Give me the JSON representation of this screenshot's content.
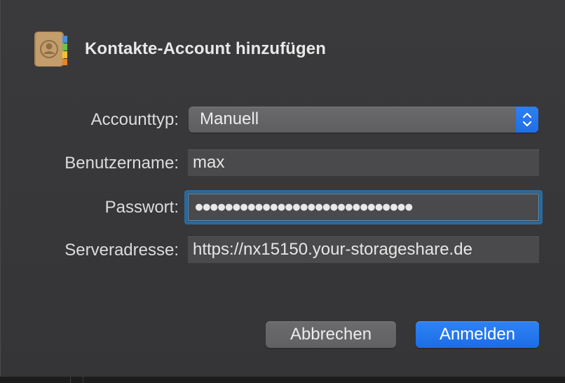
{
  "dialog": {
    "title": "Kontakte-Account hinzufügen",
    "app_icon": "contacts-app-icon"
  },
  "form": {
    "account_type": {
      "label": "Accounttyp:",
      "value": "Manuell",
      "icon": "chevron-up-down-icon"
    },
    "username": {
      "label": "Benutzername:",
      "value": "max"
    },
    "password": {
      "label": "Passwort:",
      "masked_value": "●●●●●●●●●●●●●●●●●●●●●●●●●●●●●"
    },
    "server": {
      "label": "Serveradresse:",
      "value": "https://nx15150.your-storageshare.de"
    }
  },
  "buttons": {
    "cancel": "Abbrechen",
    "confirm": "Anmelden"
  },
  "colors": {
    "accent": "#1e6fe8",
    "focus_ring": "#2a6a9e",
    "background": "#38383a"
  }
}
